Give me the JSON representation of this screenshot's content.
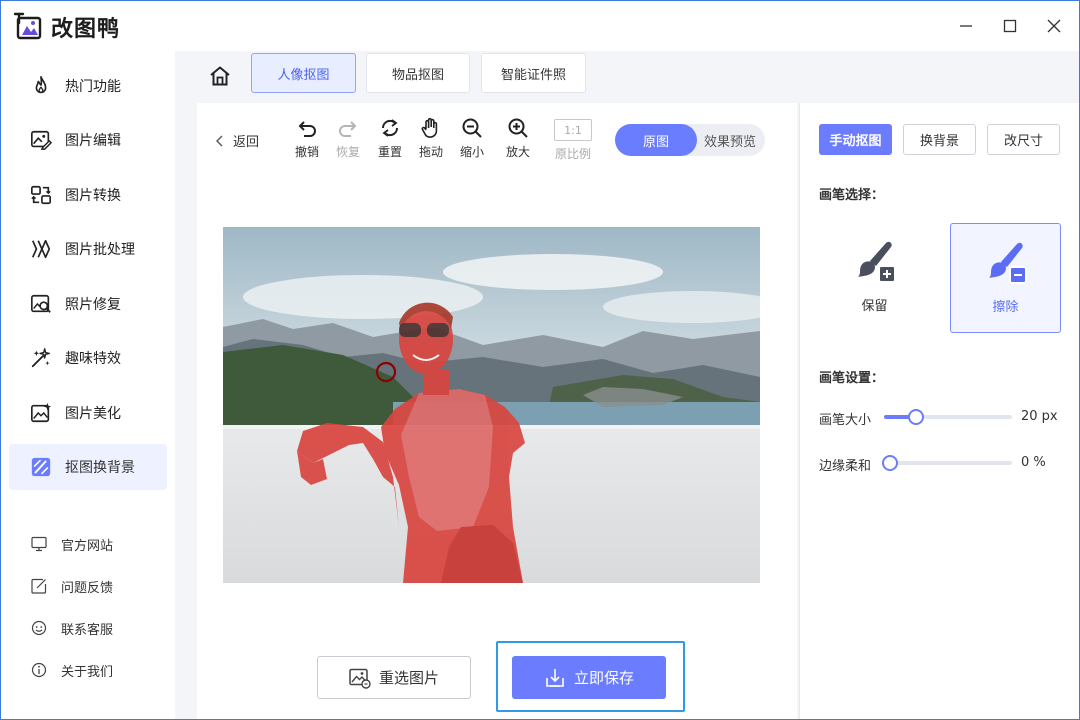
{
  "app": {
    "title": "改图鸭"
  },
  "sidebar": {
    "items": [
      {
        "label": "热门功能",
        "icon": "flame-icon"
      },
      {
        "label": "图片编辑",
        "icon": "image-edit-icon"
      },
      {
        "label": "图片转换",
        "icon": "convert-icon"
      },
      {
        "label": "图片批处理",
        "icon": "batch-icon"
      },
      {
        "label": "照片修复",
        "icon": "photo-repair-icon"
      },
      {
        "label": "趣味特效",
        "icon": "sparkle-icon"
      },
      {
        "label": "图片美化",
        "icon": "beautify-icon"
      },
      {
        "label": "抠图换背景",
        "icon": "cutout-icon",
        "active": true
      }
    ],
    "links": [
      {
        "label": "官方网站",
        "icon": "monitor-icon"
      },
      {
        "label": "问题反馈",
        "icon": "feedback-icon"
      },
      {
        "label": "联系客服",
        "icon": "support-icon"
      },
      {
        "label": "关于我们",
        "icon": "info-icon"
      }
    ]
  },
  "tabs": [
    {
      "label": "人像抠图",
      "active": true
    },
    {
      "label": "物品抠图"
    },
    {
      "label": "智能证件照"
    }
  ],
  "toolbar": {
    "back": "返回",
    "undo": "撤销",
    "redo": "恢复",
    "reset": "重置",
    "drag": "拖动",
    "zoom_out": "缩小",
    "zoom_in": "放大",
    "ratio_box": "1:1",
    "ratio": "原比例",
    "view_original": "原图",
    "view_preview": "效果预览"
  },
  "actions": {
    "reselect": "重选图片",
    "save": "立即保存"
  },
  "right_panel": {
    "modes": [
      "手动抠图",
      "换背景",
      "改尺寸"
    ],
    "brush_select_title": "画笔选择：",
    "brush_keep": "保留",
    "brush_erase": "擦除",
    "brush_settings_title": "画笔设置：",
    "brush_size_label": "画笔大小",
    "brush_size_value": "20 px",
    "brush_size_fraction": 0.2,
    "edge_soft_label": "边缘柔和",
    "edge_soft_value": "0 %",
    "edge_soft_fraction": 0
  },
  "colors": {
    "accent": "#6b7cff",
    "focus": "#2f9ae8",
    "mask": "#e23b3b"
  }
}
